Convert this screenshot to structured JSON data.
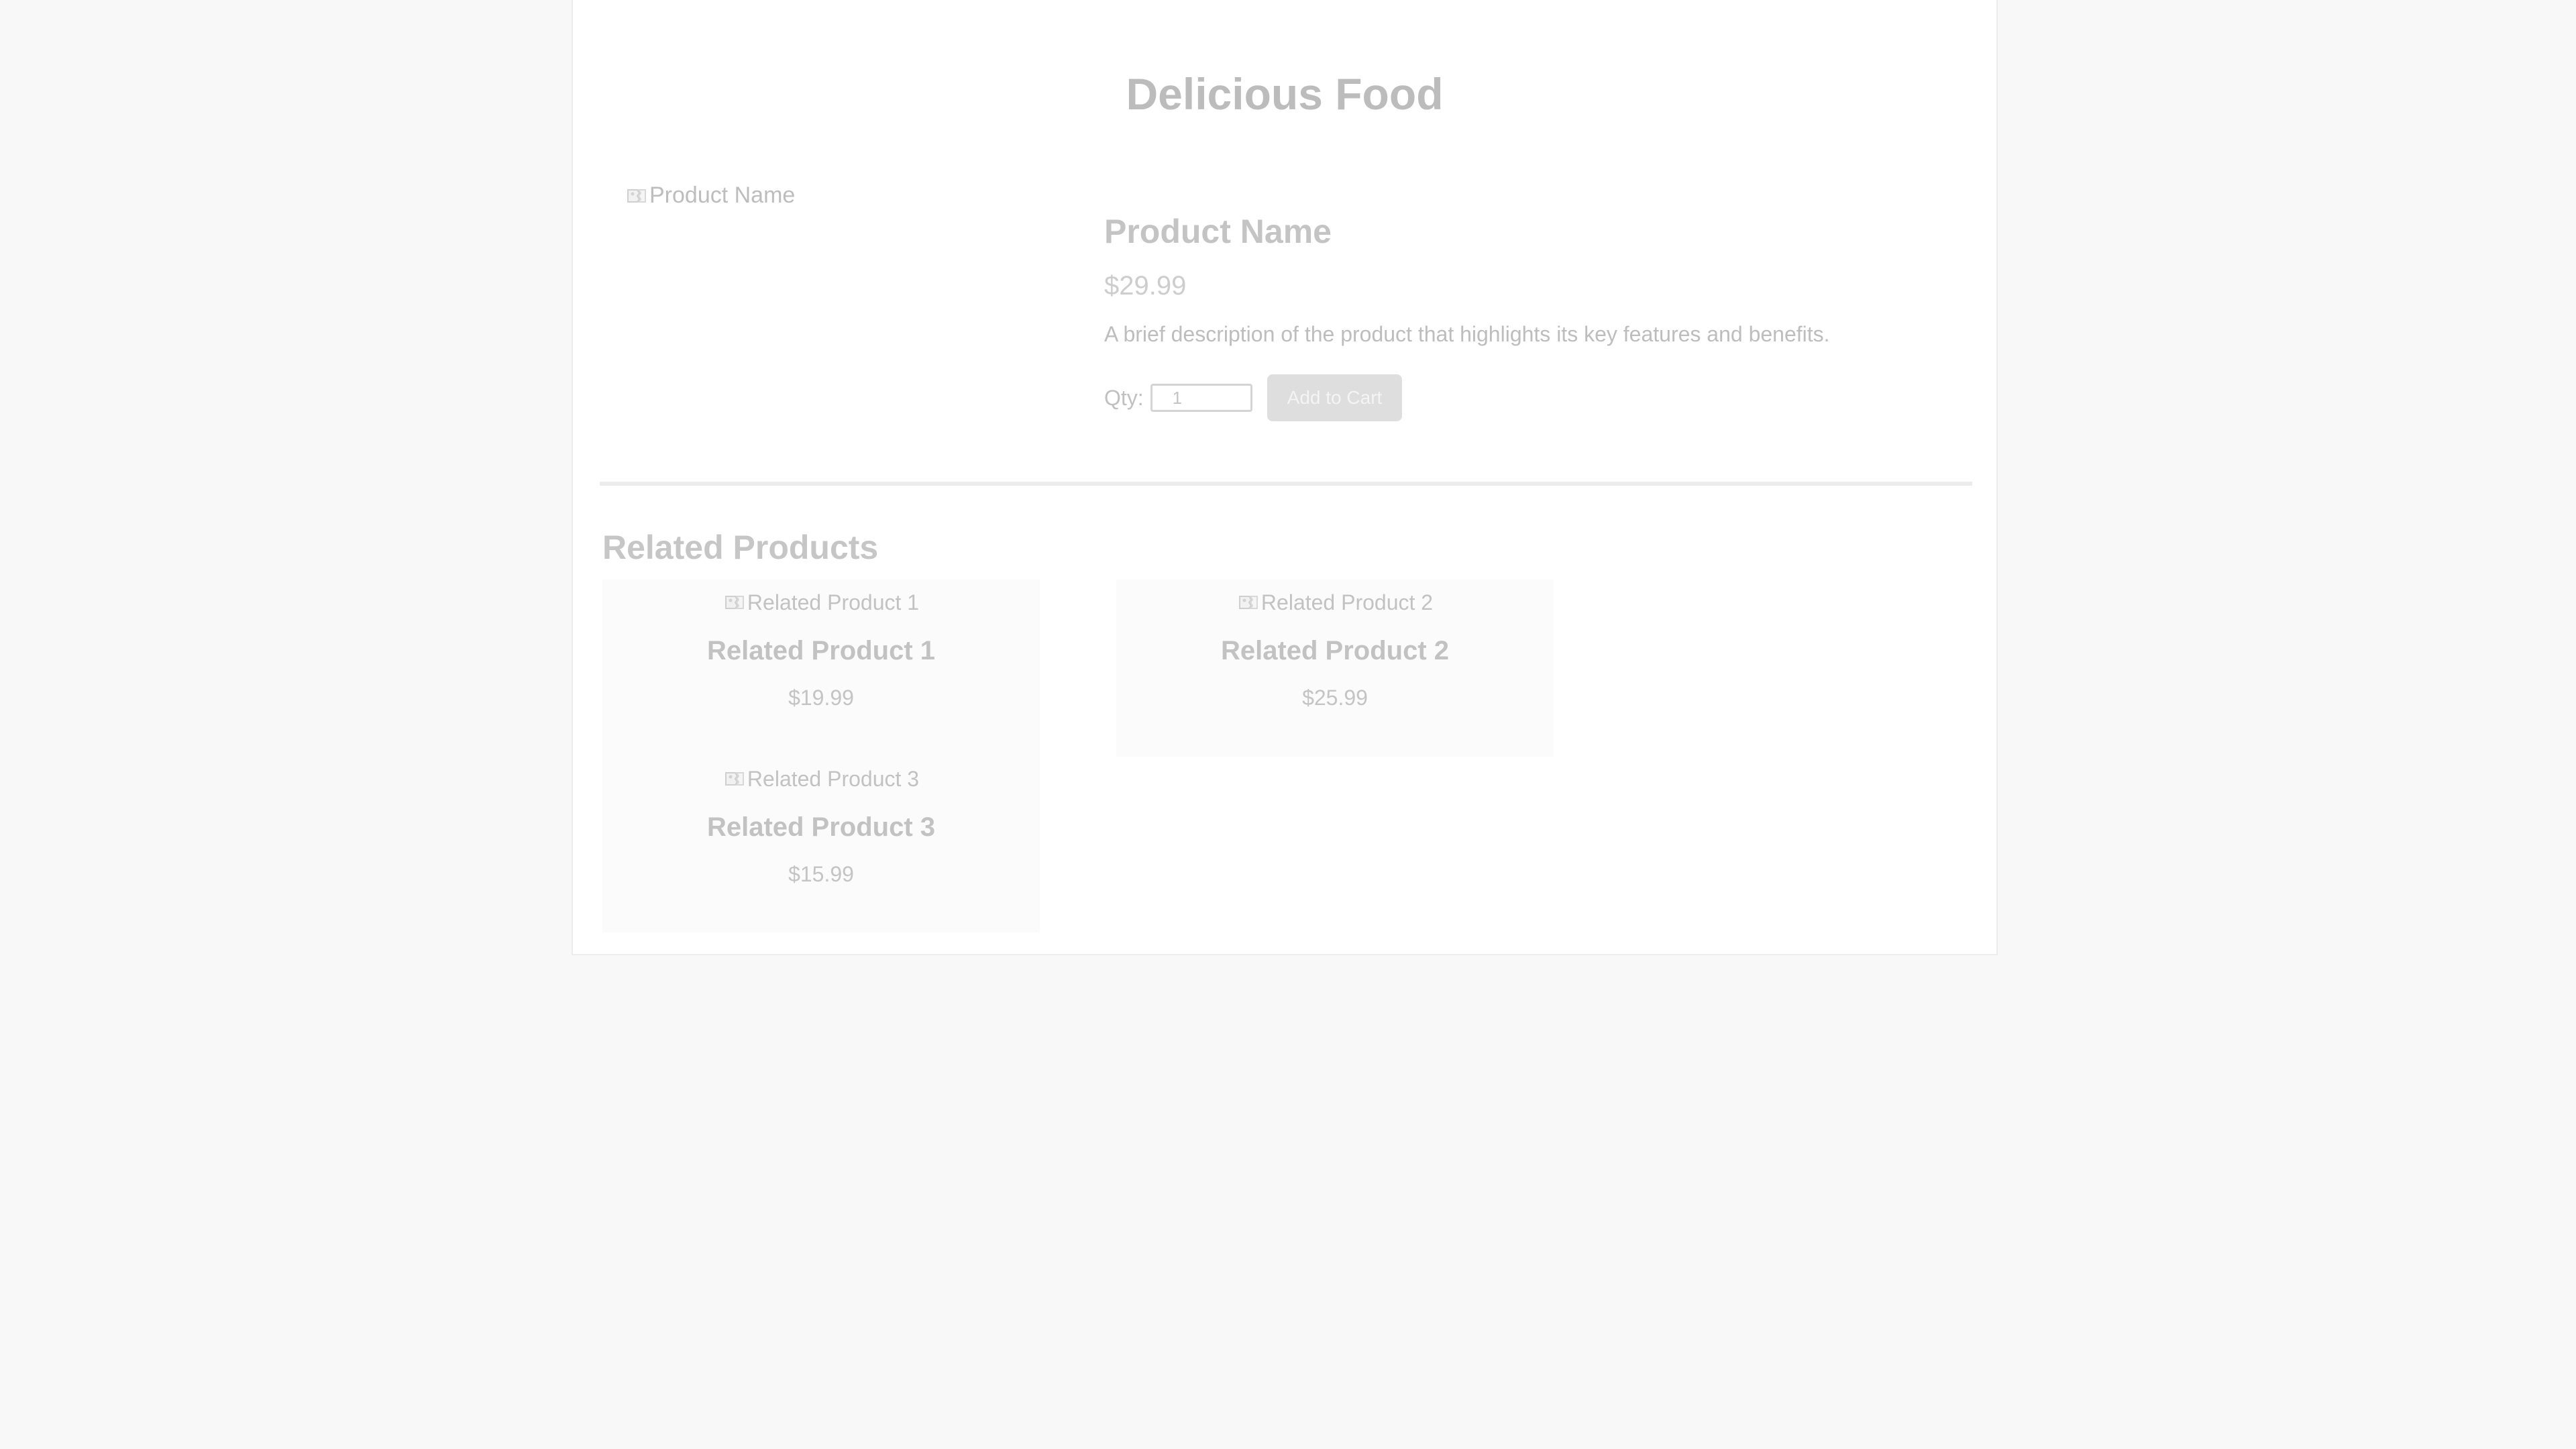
{
  "site": {
    "title": "Delicious Food"
  },
  "product": {
    "image_alt": "Product Name",
    "name": "Product Name",
    "price": "$29.99",
    "description": "A brief description of the product that highlights its key features and benefits.",
    "qty_label": "Qty:",
    "qty_value": "1",
    "add_to_cart_label": "Add to Cart"
  },
  "related": {
    "title": "Related Products",
    "items": [
      {
        "image_alt": "Related Product 1",
        "name": "Related Product 1",
        "price": "$19.99"
      },
      {
        "image_alt": "Related Product 2",
        "name": "Related Product 2",
        "price": "$25.99"
      },
      {
        "image_alt": "Related Product 3",
        "name": "Related Product 3",
        "price": "$15.99"
      }
    ]
  },
  "icons": {
    "image_placeholder": "broken-image-icon"
  },
  "colors": {
    "background": "#f8f8f8",
    "page": "#ffffff",
    "button": "#dedede",
    "text": "#c4c4c4"
  }
}
